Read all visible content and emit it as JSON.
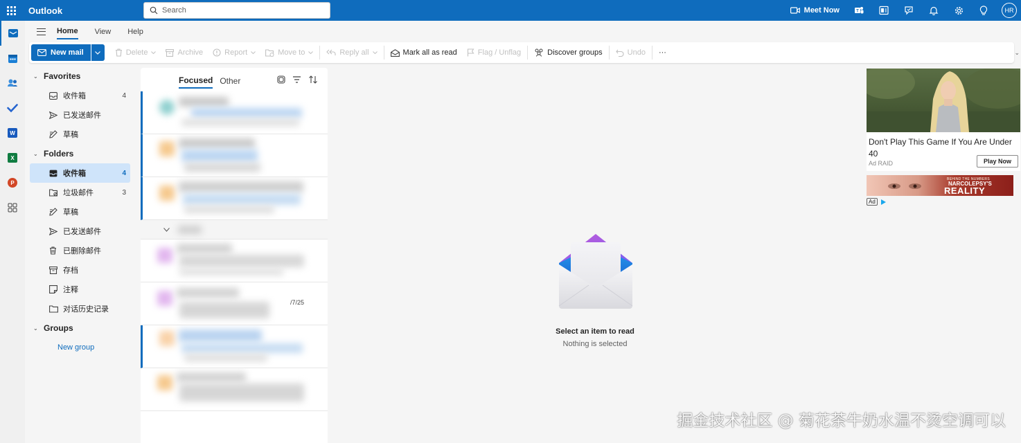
{
  "topbar": {
    "app_name": "Outlook",
    "search_placeholder": "Search",
    "meet_now": "Meet Now",
    "avatar_initials": "HR",
    "icons": [
      "meet-now-icon",
      "teams-icon",
      "office-icon",
      "my-day-icon",
      "bell-icon",
      "gear-icon",
      "lightbulb-icon"
    ]
  },
  "rail": {
    "apps": [
      "mail",
      "calendar",
      "people",
      "to-do",
      "word",
      "excel",
      "powerpoint",
      "more-apps"
    ]
  },
  "tabs": [
    "Home",
    "View",
    "Help"
  ],
  "ribbon": {
    "new_mail": "New mail",
    "delete": "Delete",
    "archive": "Archive",
    "report": "Report",
    "move_to": "Move to",
    "reply_all": "Reply all",
    "mark_all_read": "Mark all as read",
    "flag": "Flag / Unflag",
    "discover_groups": "Discover groups",
    "undo": "Undo",
    "more": "···"
  },
  "folders": {
    "favorites_title": "Favorites",
    "favorites": [
      {
        "label": "收件箱",
        "count": "4"
      },
      {
        "label": "已发送邮件",
        "count": ""
      },
      {
        "label": "草稿",
        "count": ""
      }
    ],
    "folders_title": "Folders",
    "folders": [
      {
        "label": "收件箱",
        "count": "4"
      },
      {
        "label": "垃圾邮件",
        "count": "3"
      },
      {
        "label": "草稿",
        "count": ""
      },
      {
        "label": "已发送邮件",
        "count": ""
      },
      {
        "label": "已删除邮件",
        "count": ""
      },
      {
        "label": "存档",
        "count": ""
      },
      {
        "label": "注释",
        "count": ""
      },
      {
        "label": "对话历史记录",
        "count": ""
      }
    ],
    "groups_title": "Groups",
    "new_group": "New group"
  },
  "message_list": {
    "tabs": [
      "Focused",
      "Other"
    ],
    "row_date": "/7/25"
  },
  "reading_pane": {
    "title": "Select an item to read",
    "subtitle": "Nothing is selected"
  },
  "ad": {
    "title": "Don't Play This Game If You Are Under 40",
    "source": "Ad  RAID",
    "button": "Play Now",
    "banner_tag": "BEHIND THE NUMBERS",
    "banner_sub": "NARCOLEPSY'S",
    "banner_main": "REALITY",
    "ad_label": "Ad"
  },
  "watermark": "掘金技术社区 @ 菊花茶牛奶水温不烫空调可以",
  "colors": {
    "accent": "#0f6cbd",
    "selected": "#cfe4fa"
  }
}
